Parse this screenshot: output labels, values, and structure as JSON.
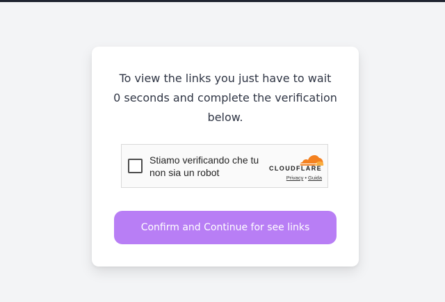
{
  "message": {
    "line1": "To view the links you just have to wait",
    "line2": "0 seconds and complete the verification",
    "line3": "below."
  },
  "captcha": {
    "label_line1": "Stiamo verificando che tu",
    "label_line2": "non sia un robot",
    "brand": "CLOUDFLARE",
    "privacy_link": "Privacy",
    "separator": "•",
    "guide_link": "Guida",
    "checked": false
  },
  "button": {
    "label": "Confirm and Continue for see links"
  },
  "colors": {
    "accent": "#b87ef5",
    "page_background": "#f3f4f6",
    "top_bar": "#1f2330",
    "cloudflare_orange": "#f48120",
    "cloudflare_light_orange": "#faae40"
  },
  "icons": {
    "cloud_logo": "cloudflare-cloud-icon"
  }
}
